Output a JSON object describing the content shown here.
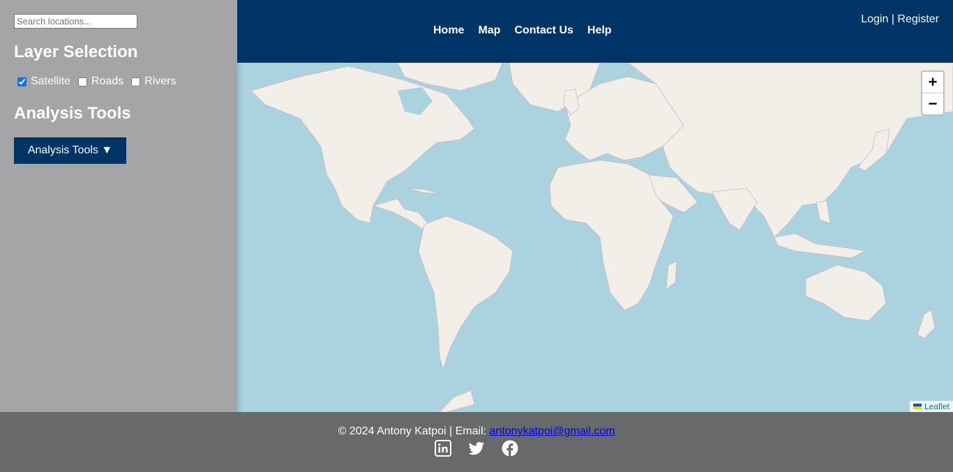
{
  "sidebar": {
    "search_placeholder": "Search locations...",
    "layer_heading": "Layer Selection",
    "layers": [
      {
        "label": "Satellite",
        "checked": true
      },
      {
        "label": "Roads",
        "checked": false
      },
      {
        "label": "Rivers",
        "checked": false
      }
    ],
    "tools_heading": "Analysis Tools",
    "tools_button": "Analysis Tools ▼"
  },
  "header": {
    "nav": [
      "Home",
      "Map",
      "Contact Us",
      "Help"
    ],
    "login": "Login",
    "separator": "|",
    "register": "Register"
  },
  "map": {
    "zoom_in": "+",
    "zoom_out": "−",
    "attribution": "Leaflet",
    "water_color": "#aad3df",
    "land_color": "#f2efe9"
  },
  "footer": {
    "text": "© 2024 Antony Katpoi | Email: ",
    "email": "antonykatpoi@gmail.com",
    "social": [
      "linkedin-icon",
      "twitter-icon",
      "facebook-icon"
    ]
  },
  "colors": {
    "navy": "#003366",
    "sidebar": "#a5a5a7",
    "footer": "#68696b"
  }
}
